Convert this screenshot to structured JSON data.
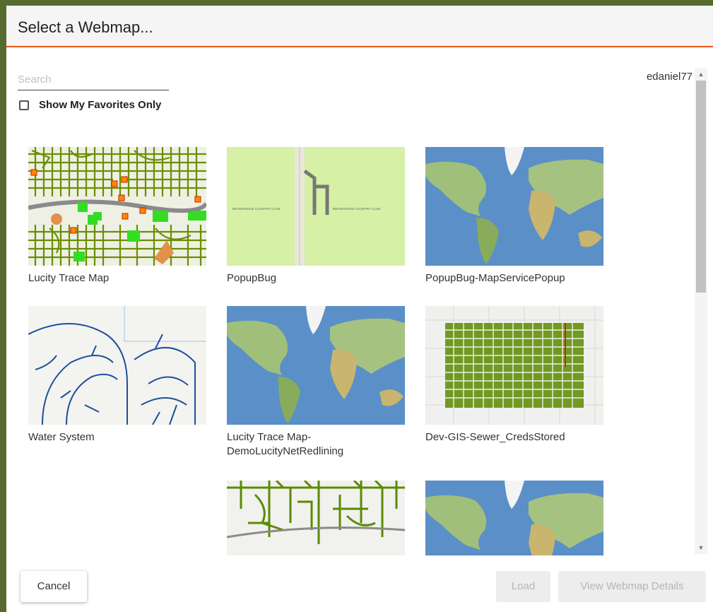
{
  "dialog": {
    "title": "Select a Webmap..."
  },
  "search": {
    "placeholder": "Search",
    "value": ""
  },
  "favorites": {
    "label": "Show My Favorites Only",
    "checked": false
  },
  "user": {
    "name": "edaniel77"
  },
  "webmaps": [
    {
      "title": "Lucity Trace Map",
      "thumbnail": "street-network-map"
    },
    {
      "title": "PopupBug",
      "thumbnail": "golf-course-map"
    },
    {
      "title": "PopupBug-MapServicePopup",
      "thumbnail": "world-imagery-map"
    },
    {
      "title": "Water System",
      "thumbnail": "water-lines-map"
    },
    {
      "title": "Lucity Trace Map-DemoLucityNetRedlining",
      "thumbnail": "world-imagery-map"
    },
    {
      "title": "Dev-GIS-Sewer_CredsStored",
      "thumbnail": "sewer-grid-map"
    },
    {
      "title": "",
      "thumbnail": "street-network-map"
    },
    {
      "title": "",
      "thumbnail": "world-imagery-map"
    }
  ],
  "map_labels": {
    "golf_left": "BROOKRIDGE COUNTRY CLUB",
    "golf_right": "BROOKRIDGE COUNTRY CLUB"
  },
  "buttons": {
    "cancel": "Cancel",
    "load": "Load",
    "details": "View Webmap Details"
  },
  "colors": {
    "frame": "#556b2f",
    "header_underline": "#e8571e",
    "network_green": "#5a8a00",
    "water_blue": "#1f4e9c",
    "ocean": "#5b8fc7",
    "land": "#9fbf7a"
  }
}
